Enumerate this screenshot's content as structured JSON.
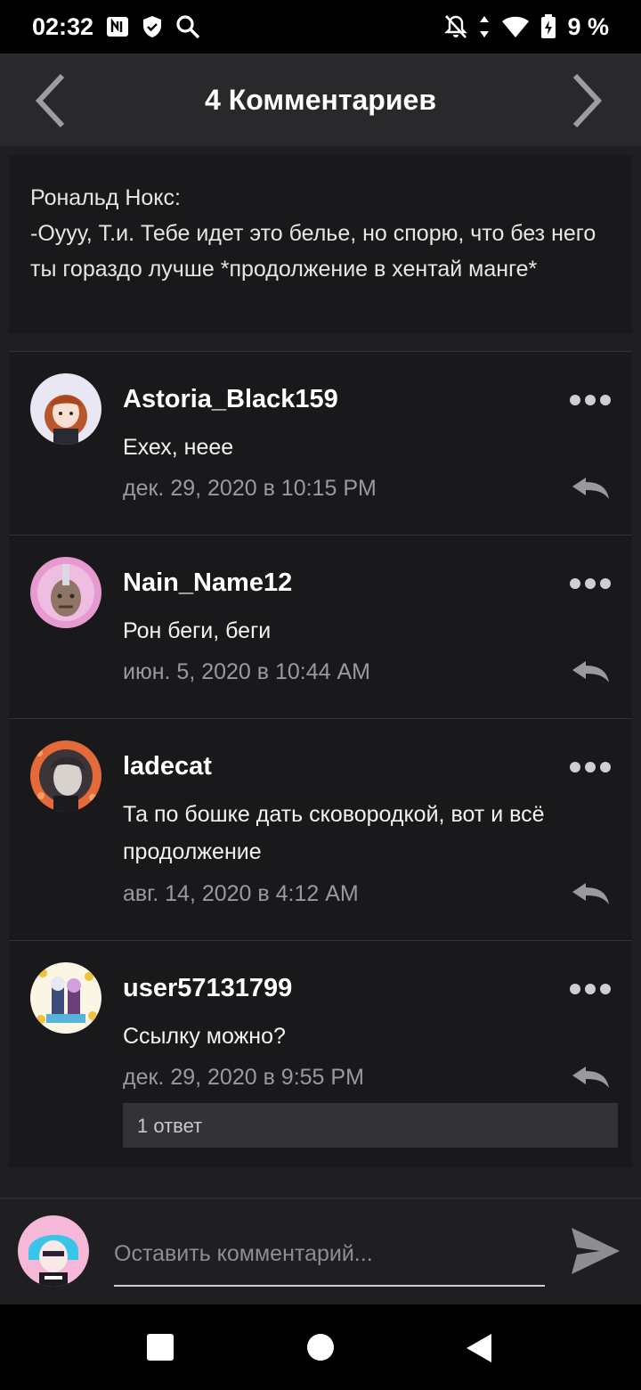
{
  "status_bar": {
    "time": "02:32",
    "battery": "9 %",
    "icons": [
      "nfc-icon",
      "shield-icon",
      "search-icon",
      "notifications-off-icon",
      "data-arrows-icon",
      "wifi-icon",
      "battery-charging-icon"
    ]
  },
  "header": {
    "title": "4 Комментариев",
    "prev_icon": "chevron-left-icon",
    "next_icon": "chevron-right-icon"
  },
  "quote": {
    "author": "Рональд Нокс:",
    "text": "-Оууу, Т.и. Тебе идет это белье, но спорю, что без него ты гораздо лучше *продолжение в хентай манге*"
  },
  "comments": [
    {
      "username": "Astoria_Black159",
      "text": "Ехех, неее",
      "date": "дек. 29, 2020 в 10:15 PM"
    },
    {
      "username": "Nain_Name12",
      "text": "Рон беги, беги",
      "date": "июн. 5, 2020 в 10:44 AM"
    },
    {
      "username": "ladecat",
      "text": "Та по бошке дать сковородкой, вот и всё продолжение",
      "date": "авг. 14, 2020 в 4:12 AM"
    },
    {
      "username": "user57131799",
      "text": "Ссылку можно?",
      "date": "дек. 29, 2020 в 9:55 PM",
      "replies": "1 ответ"
    }
  ],
  "composer": {
    "placeholder": "Оставить комментарий...",
    "send_icon": "send-icon"
  },
  "colors": {
    "background": "#1f1e21",
    "header": "#29282b",
    "card": "#19181b",
    "date_text": "#9a9a9d"
  }
}
